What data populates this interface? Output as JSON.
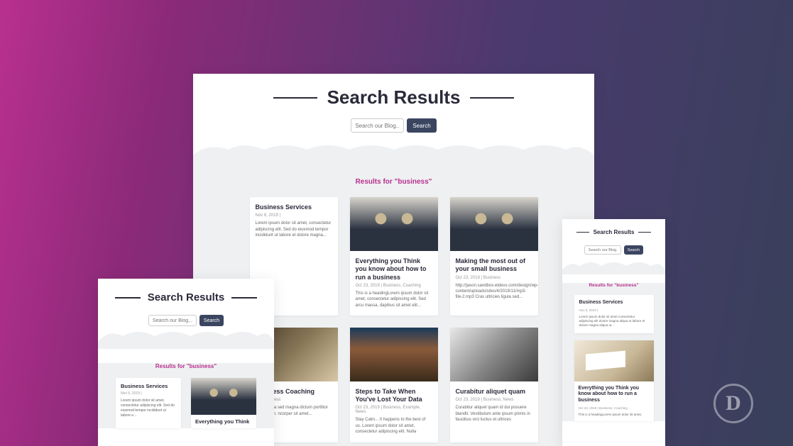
{
  "page_title": "Search Results",
  "search": {
    "placeholder": "Search our Blog...",
    "button": "Search"
  },
  "results_label": "Results for \"business\"",
  "colors": {
    "accent": "#b8308e",
    "button_bg": "#3a4560"
  },
  "desktop_cards": [
    {
      "title": "Business Services",
      "meta": "Nov 6, 2019 |",
      "excerpt": "Lorem ipsum dolor sit amet, consectetur adipiscing elit. Sed do eiusmod tempor incididunt ut labore et dolore magna...",
      "has_image": false
    },
    {
      "title": "Everything you Think you know about how to run a business",
      "meta": "Oct 23, 2019 | Business, Coaching",
      "excerpt": "This is a headingLorem ipsum dolor sit amet, consectetur adipiscing elit. Sed arcu massa, dapibus sit amet elit...",
      "has_image": true,
      "img": "img-suits"
    },
    {
      "title": "Making the most out of your small business",
      "meta": "Oct 23, 2019 | Business",
      "excerpt": "http://jason.sandbox.etdevs.com/design/wp-content/uploads/sites/4/2019/11/mp3-file-2.mp3 Cras ultricies ligula sed...",
      "has_image": true,
      "img": "img-suits"
    },
    {
      "title": "Business Coaching",
      "meta": "19 | Business",
      "excerpt": "ricies ligula sed magna dictum porttitor lectus nibh. ncorper sit amet...",
      "has_image": true,
      "img": "img-desk"
    },
    {
      "title": "Steps to Take When You've Lost Your Data",
      "meta": "Oct 23, 2019 | Business, Example, News",
      "excerpt": "Stay Calm... It happens to the best of us. Lorem ipsum dolor sit amet, consectetur adipiscing elit. Nulla",
      "has_image": true,
      "img": "img-road"
    },
    {
      "title": "Curabitur aliquet quam",
      "meta": "Oct 23, 2019 | Business, News",
      "excerpt": "Curabitur aliquet quam id dui posuere blandit. Vestibulum ante ipsum primis in faucibus orci luctus et ultrices",
      "has_image": true,
      "img": "img-handshake"
    }
  ],
  "tablet_cards": [
    {
      "title": "Business Services",
      "meta": "Nov 6, 2019 |",
      "excerpt": "Lorem ipsum dolor sit amet, consectetur adipiscing elit. Sed do eiusmod tempor incididunt ut labore e...",
      "has_image": false
    },
    {
      "title": "Everything you Think",
      "has_image": true,
      "img": "img-suits"
    }
  ],
  "mobile_cards": [
    {
      "title": "Business Services",
      "meta": "Nov 6, 2019 |",
      "excerpt": "Lorem ipsum dolor sit amet consectetur adipiscing elit dolore magna aliqua ut labore et dolore magna aliqua ut...",
      "has_image": false
    },
    {
      "title": "Everything you Think you know about how to run a business",
      "meta": "Oct 23, 2019 | Business, Coaching",
      "excerpt": "This is a headingLorem ipsum dolor sit amet,",
      "has_image": true,
      "img": "img-book"
    }
  ]
}
